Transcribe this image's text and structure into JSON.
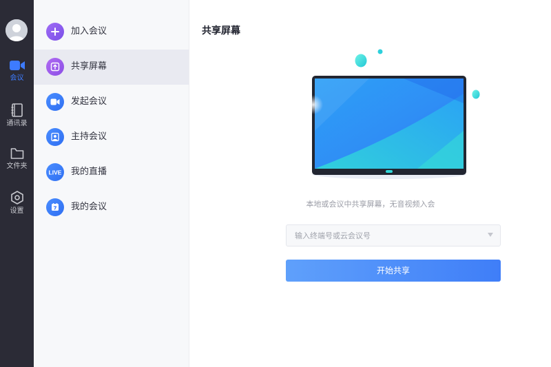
{
  "rail": {
    "items": [
      {
        "label": "会议",
        "icon": "video-camera-icon",
        "active": true
      },
      {
        "label": "通讯录",
        "icon": "contacts-book-icon",
        "active": false
      },
      {
        "label": "文件夹",
        "icon": "folder-icon",
        "active": false
      },
      {
        "label": "设置",
        "icon": "settings-hexagon-icon",
        "active": false
      }
    ]
  },
  "menu": {
    "items": [
      {
        "label": "加入会议",
        "icon": "plus-icon",
        "color": "#8a5cf0",
        "active": false
      },
      {
        "label": "共享屏幕",
        "icon": "share-screen-icon",
        "color": "#9b5cf0",
        "active": true
      },
      {
        "label": "发起会议",
        "icon": "video-camera-icon",
        "color": "#3d7bff",
        "active": false
      },
      {
        "label": "主持会议",
        "icon": "host-user-icon",
        "color": "#3d7bff",
        "active": false
      },
      {
        "label": "我的直播",
        "icon": "live-icon",
        "color": "#3d7bff",
        "active": false
      },
      {
        "label": "我的会议",
        "icon": "calendar-icon",
        "color": "#3d7bff",
        "active": false
      }
    ]
  },
  "main": {
    "title": "共享屏幕",
    "caption": "本地或会议中共享屏幕，无音视频入会",
    "input_placeholder": "输入终端号或云会议号",
    "input_value": "",
    "start_button": "开始共享"
  },
  "colors": {
    "accent": "#3d7bff",
    "rail_bg": "#2b2b36",
    "menu_bg": "#f7f8fa",
    "menu_active_bg": "#e9eaf1"
  }
}
